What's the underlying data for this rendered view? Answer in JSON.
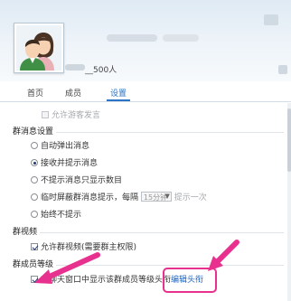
{
  "header": {
    "member_count": "__500人"
  },
  "tabs": [
    {
      "label": "首页",
      "active": false
    },
    {
      "label": "成员",
      "active": false
    },
    {
      "label": "设置",
      "active": true
    }
  ],
  "settings": {
    "allow_visitor": "允许游客发言",
    "message_section": {
      "title": "群消息设置",
      "options": [
        {
          "label": "自动弹出消息",
          "selected": false
        },
        {
          "label": "接收并提示消息",
          "selected": true
        },
        {
          "label": "不提示消息只显示数目",
          "selected": false
        }
      ],
      "timed_option": {
        "prefix": "临时屏蔽群消息提示，每隔",
        "select_value": "15分钟",
        "suffix": "提示一次",
        "selected": false
      },
      "block_option": {
        "label": "始终不提示",
        "selected": false
      }
    },
    "video_section": {
      "title": "群视频",
      "allow_video": "允许群视频(需要群主权限)",
      "checked": true
    },
    "level_section": {
      "title": "群成员等级",
      "show_level": "在聊天窗口中显示该群成员等级头衔",
      "checked": true,
      "edit_link": "编辑头衔"
    }
  },
  "colors": {
    "accent": "#2a73c6",
    "arrow": "#e8308f",
    "link": "#1d63c2"
  }
}
